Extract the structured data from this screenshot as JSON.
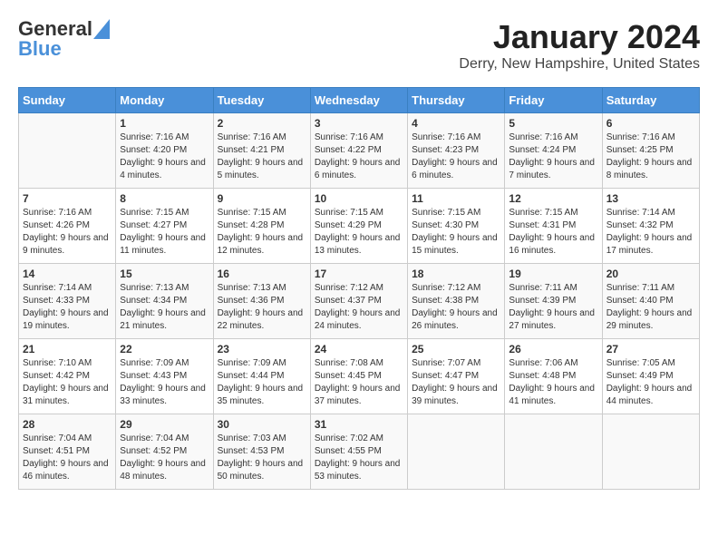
{
  "header": {
    "logo_line1": "General",
    "logo_line2": "Blue",
    "month_year": "January 2024",
    "location": "Derry, New Hampshire, United States"
  },
  "days_of_week": [
    "Sunday",
    "Monday",
    "Tuesday",
    "Wednesday",
    "Thursday",
    "Friday",
    "Saturday"
  ],
  "weeks": [
    [
      {
        "day": "",
        "sunrise": "",
        "sunset": "",
        "daylight": ""
      },
      {
        "day": "1",
        "sunrise": "Sunrise: 7:16 AM",
        "sunset": "Sunset: 4:20 PM",
        "daylight": "Daylight: 9 hours and 4 minutes."
      },
      {
        "day": "2",
        "sunrise": "Sunrise: 7:16 AM",
        "sunset": "Sunset: 4:21 PM",
        "daylight": "Daylight: 9 hours and 5 minutes."
      },
      {
        "day": "3",
        "sunrise": "Sunrise: 7:16 AM",
        "sunset": "Sunset: 4:22 PM",
        "daylight": "Daylight: 9 hours and 6 minutes."
      },
      {
        "day": "4",
        "sunrise": "Sunrise: 7:16 AM",
        "sunset": "Sunset: 4:23 PM",
        "daylight": "Daylight: 9 hours and 6 minutes."
      },
      {
        "day": "5",
        "sunrise": "Sunrise: 7:16 AM",
        "sunset": "Sunset: 4:24 PM",
        "daylight": "Daylight: 9 hours and 7 minutes."
      },
      {
        "day": "6",
        "sunrise": "Sunrise: 7:16 AM",
        "sunset": "Sunset: 4:25 PM",
        "daylight": "Daylight: 9 hours and 8 minutes."
      }
    ],
    [
      {
        "day": "7",
        "sunrise": "Sunrise: 7:16 AM",
        "sunset": "Sunset: 4:26 PM",
        "daylight": "Daylight: 9 hours and 9 minutes."
      },
      {
        "day": "8",
        "sunrise": "Sunrise: 7:15 AM",
        "sunset": "Sunset: 4:27 PM",
        "daylight": "Daylight: 9 hours and 11 minutes."
      },
      {
        "day": "9",
        "sunrise": "Sunrise: 7:15 AM",
        "sunset": "Sunset: 4:28 PM",
        "daylight": "Daylight: 9 hours and 12 minutes."
      },
      {
        "day": "10",
        "sunrise": "Sunrise: 7:15 AM",
        "sunset": "Sunset: 4:29 PM",
        "daylight": "Daylight: 9 hours and 13 minutes."
      },
      {
        "day": "11",
        "sunrise": "Sunrise: 7:15 AM",
        "sunset": "Sunset: 4:30 PM",
        "daylight": "Daylight: 9 hours and 15 minutes."
      },
      {
        "day": "12",
        "sunrise": "Sunrise: 7:15 AM",
        "sunset": "Sunset: 4:31 PM",
        "daylight": "Daylight: 9 hours and 16 minutes."
      },
      {
        "day": "13",
        "sunrise": "Sunrise: 7:14 AM",
        "sunset": "Sunset: 4:32 PM",
        "daylight": "Daylight: 9 hours and 17 minutes."
      }
    ],
    [
      {
        "day": "14",
        "sunrise": "Sunrise: 7:14 AM",
        "sunset": "Sunset: 4:33 PM",
        "daylight": "Daylight: 9 hours and 19 minutes."
      },
      {
        "day": "15",
        "sunrise": "Sunrise: 7:13 AM",
        "sunset": "Sunset: 4:34 PM",
        "daylight": "Daylight: 9 hours and 21 minutes."
      },
      {
        "day": "16",
        "sunrise": "Sunrise: 7:13 AM",
        "sunset": "Sunset: 4:36 PM",
        "daylight": "Daylight: 9 hours and 22 minutes."
      },
      {
        "day": "17",
        "sunrise": "Sunrise: 7:12 AM",
        "sunset": "Sunset: 4:37 PM",
        "daylight": "Daylight: 9 hours and 24 minutes."
      },
      {
        "day": "18",
        "sunrise": "Sunrise: 7:12 AM",
        "sunset": "Sunset: 4:38 PM",
        "daylight": "Daylight: 9 hours and 26 minutes."
      },
      {
        "day": "19",
        "sunrise": "Sunrise: 7:11 AM",
        "sunset": "Sunset: 4:39 PM",
        "daylight": "Daylight: 9 hours and 27 minutes."
      },
      {
        "day": "20",
        "sunrise": "Sunrise: 7:11 AM",
        "sunset": "Sunset: 4:40 PM",
        "daylight": "Daylight: 9 hours and 29 minutes."
      }
    ],
    [
      {
        "day": "21",
        "sunrise": "Sunrise: 7:10 AM",
        "sunset": "Sunset: 4:42 PM",
        "daylight": "Daylight: 9 hours and 31 minutes."
      },
      {
        "day": "22",
        "sunrise": "Sunrise: 7:09 AM",
        "sunset": "Sunset: 4:43 PM",
        "daylight": "Daylight: 9 hours and 33 minutes."
      },
      {
        "day": "23",
        "sunrise": "Sunrise: 7:09 AM",
        "sunset": "Sunset: 4:44 PM",
        "daylight": "Daylight: 9 hours and 35 minutes."
      },
      {
        "day": "24",
        "sunrise": "Sunrise: 7:08 AM",
        "sunset": "Sunset: 4:45 PM",
        "daylight": "Daylight: 9 hours and 37 minutes."
      },
      {
        "day": "25",
        "sunrise": "Sunrise: 7:07 AM",
        "sunset": "Sunset: 4:47 PM",
        "daylight": "Daylight: 9 hours and 39 minutes."
      },
      {
        "day": "26",
        "sunrise": "Sunrise: 7:06 AM",
        "sunset": "Sunset: 4:48 PM",
        "daylight": "Daylight: 9 hours and 41 minutes."
      },
      {
        "day": "27",
        "sunrise": "Sunrise: 7:05 AM",
        "sunset": "Sunset: 4:49 PM",
        "daylight": "Daylight: 9 hours and 44 minutes."
      }
    ],
    [
      {
        "day": "28",
        "sunrise": "Sunrise: 7:04 AM",
        "sunset": "Sunset: 4:51 PM",
        "daylight": "Daylight: 9 hours and 46 minutes."
      },
      {
        "day": "29",
        "sunrise": "Sunrise: 7:04 AM",
        "sunset": "Sunset: 4:52 PM",
        "daylight": "Daylight: 9 hours and 48 minutes."
      },
      {
        "day": "30",
        "sunrise": "Sunrise: 7:03 AM",
        "sunset": "Sunset: 4:53 PM",
        "daylight": "Daylight: 9 hours and 50 minutes."
      },
      {
        "day": "31",
        "sunrise": "Sunrise: 7:02 AM",
        "sunset": "Sunset: 4:55 PM",
        "daylight": "Daylight: 9 hours and 53 minutes."
      },
      {
        "day": "",
        "sunrise": "",
        "sunset": "",
        "daylight": ""
      },
      {
        "day": "",
        "sunrise": "",
        "sunset": "",
        "daylight": ""
      },
      {
        "day": "",
        "sunrise": "",
        "sunset": "",
        "daylight": ""
      }
    ]
  ]
}
